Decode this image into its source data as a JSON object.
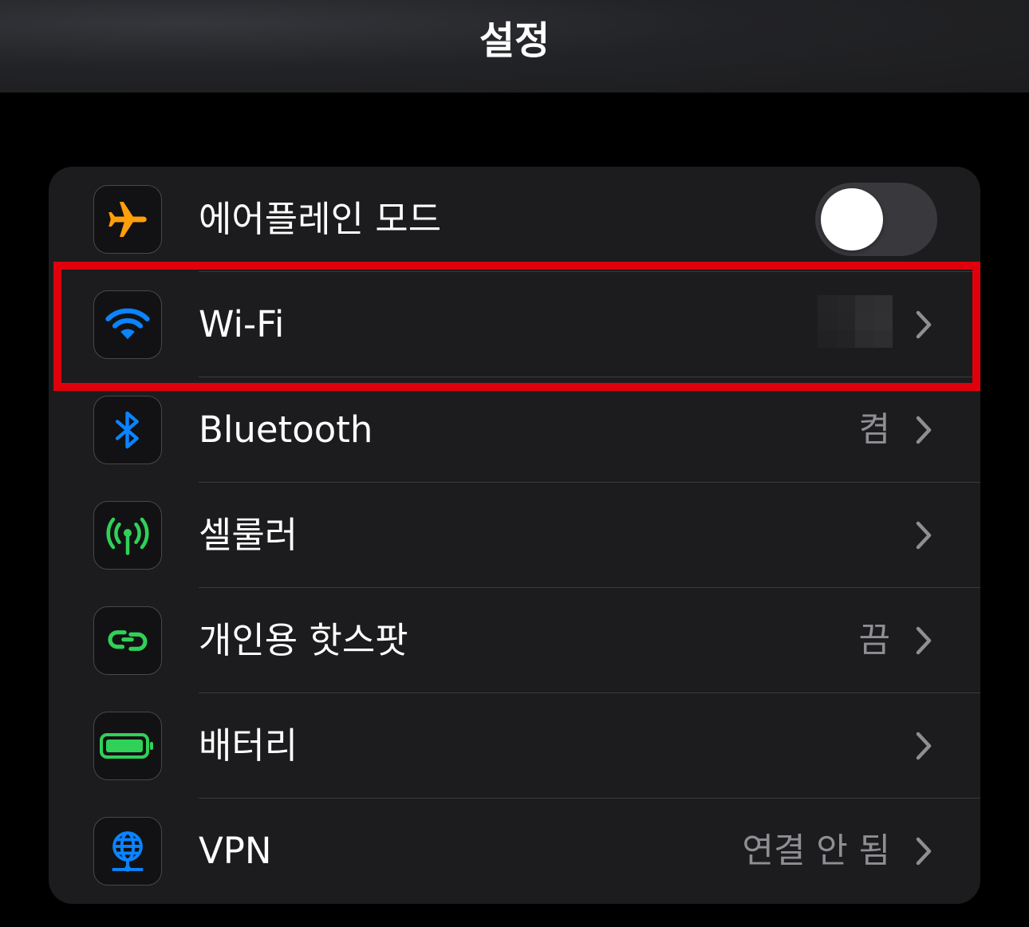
{
  "header": {
    "title": "설정"
  },
  "rows": [
    {
      "label": "에어플레인 모드",
      "icon": "airplane-icon",
      "icon_color": "#ff9f0a",
      "toggle": "off"
    },
    {
      "label": "Wi-Fi",
      "icon": "wifi-icon",
      "icon_color": "#0a84ff",
      "value_redacted": true
    },
    {
      "label": "Bluetooth",
      "icon": "bluetooth-icon",
      "icon_color": "#0a84ff",
      "value": "켬"
    },
    {
      "label": "셀룰러",
      "icon": "cellular-icon",
      "icon_color": "#30d158"
    },
    {
      "label": "개인용 핫스팟",
      "icon": "hotspot-icon",
      "icon_color": "#30d158",
      "value": "끔"
    },
    {
      "label": "배터리",
      "icon": "battery-icon",
      "icon_color": "#30d158"
    },
    {
      "label": "VPN",
      "icon": "vpn-icon",
      "icon_color": "#0a84ff",
      "value": "연결 안 됨"
    }
  ],
  "highlight": {
    "target": "Wi-Fi",
    "color": "#e0000b"
  },
  "colors": {
    "background": "#000000",
    "group": "#1c1c1e",
    "secondary_text": "#8e8e93",
    "separator": "#3a3a3c"
  }
}
